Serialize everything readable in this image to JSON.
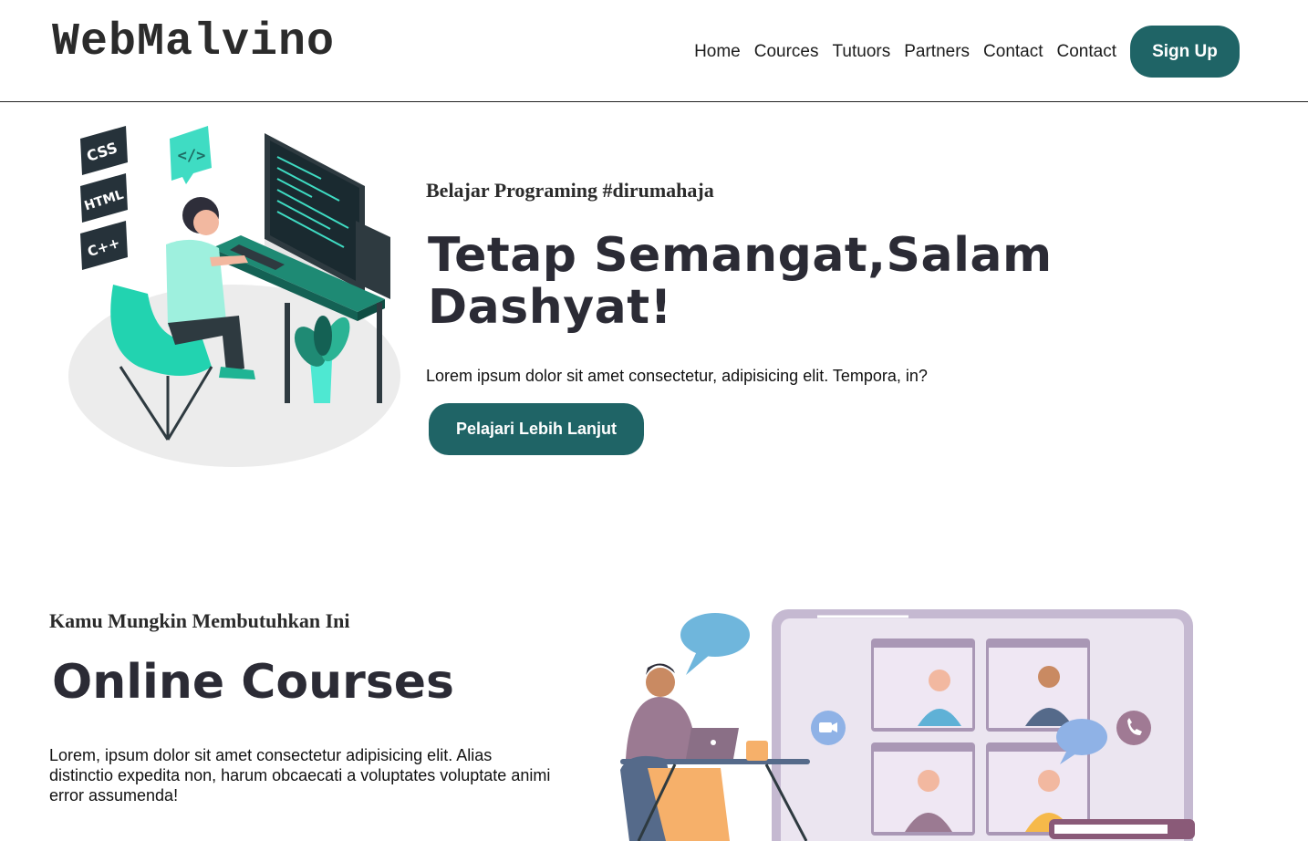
{
  "header": {
    "logo": "WebMalvino",
    "nav": [
      "Home",
      "Cources",
      "Tutuors",
      "Partners",
      "Contact",
      "Contact"
    ],
    "signup_label": "Sign Up"
  },
  "hero": {
    "eyebrow": "Belajar Programing #dirumahaja",
    "title": "Tetap Semangat,Salam Dashyat!",
    "description": "Lorem ipsum dolor sit amet consectetur, adipisicing elit. Tempora, in?",
    "cta_label": "Pelajari Lebih Lanjut",
    "illustration": {
      "badges": [
        "CSS",
        "HTML",
        "C++"
      ],
      "code_tag": "</>"
    }
  },
  "courses": {
    "eyebrow": "Kamu Mungkin Membutuhkan Ini",
    "title": "Online Courses",
    "description": "Lorem, ipsum dolor sit amet consectetur adipisicing elit. Alias distinctio expedita non, harum obcaecati a voluptates voluptate animi error assumenda!"
  },
  "colors": {
    "primary": "#1f6466",
    "accent": "#1fd1b0",
    "text": "#2b2b35"
  }
}
